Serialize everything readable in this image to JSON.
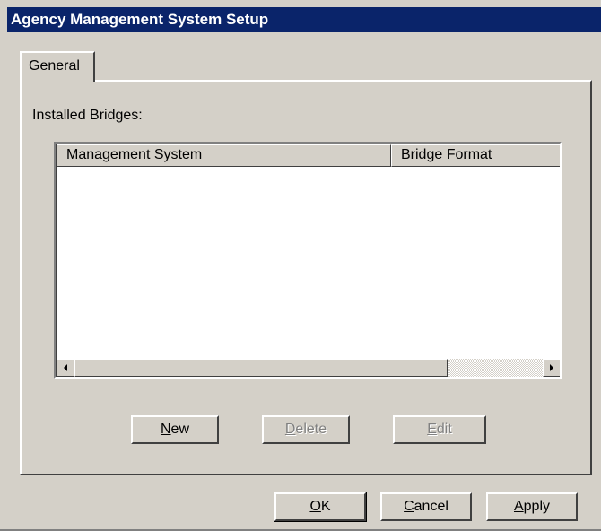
{
  "window": {
    "title": "Agency Management System Setup"
  },
  "tabs": [
    {
      "label": "General",
      "active": true
    }
  ],
  "general": {
    "installed_label": "Installed Bridges:",
    "columns": [
      "Management System",
      "Bridge Format"
    ],
    "rows": []
  },
  "panel_buttons": {
    "new": {
      "mnemonic": "N",
      "rest": "ew",
      "enabled": true
    },
    "delete": {
      "mnemonic": "D",
      "rest": "elete",
      "enabled": false
    },
    "edit": {
      "mnemonic": "E",
      "rest": "dit",
      "enabled": false
    }
  },
  "dialog_buttons": {
    "ok": {
      "mnemonic": "O",
      "rest": "K"
    },
    "cancel": {
      "mnemonic": "C",
      "rest": "ancel"
    },
    "apply": {
      "mnemonic": "A",
      "rest": "pply"
    }
  },
  "icons": {
    "scroll_left": "arrow-left-icon",
    "scroll_right": "arrow-right-icon"
  },
  "colors": {
    "titlebar": "#0a246a",
    "face": "#d4d0c8",
    "disabled_text": "#808080"
  }
}
